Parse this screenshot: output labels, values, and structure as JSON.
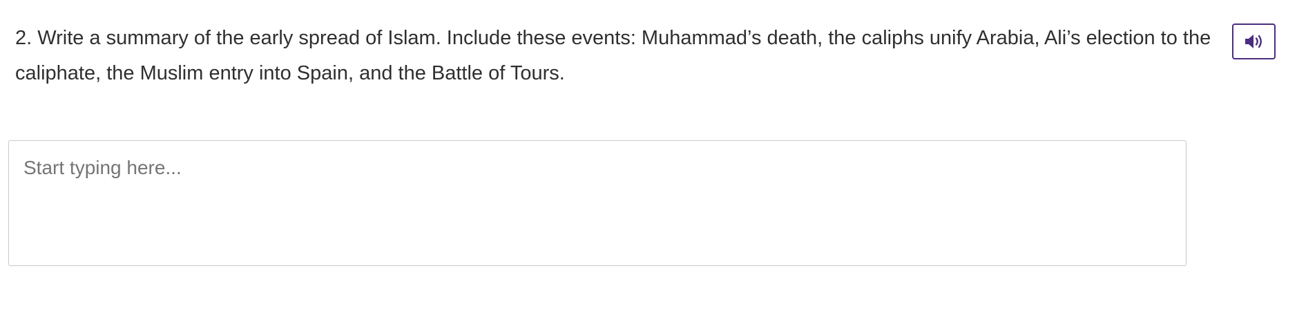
{
  "question": {
    "text": "2. Write a summary of the early spread of Islam. Include these events: Muhammad’s death, the caliphs unify Arabia, Ali’s election to the caliphate, the Muslim entry into Spain, and the Battle of Tours."
  },
  "audio_button": {
    "icon": "speaker-icon",
    "color": "#4b2d7f"
  },
  "answer": {
    "placeholder": "Start typing here...",
    "value": ""
  }
}
